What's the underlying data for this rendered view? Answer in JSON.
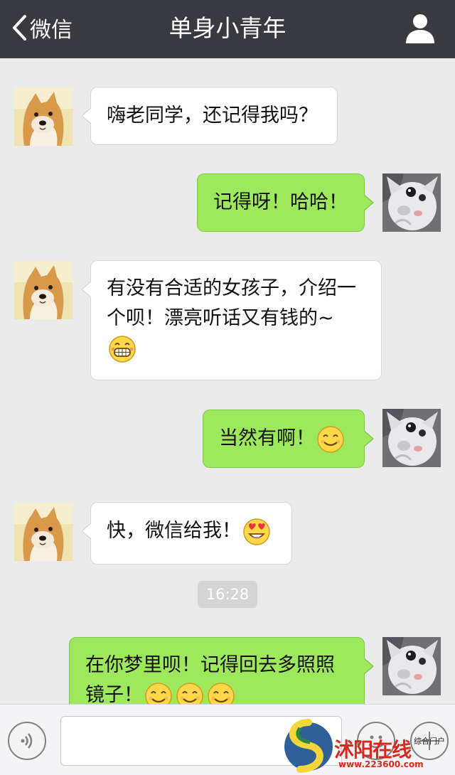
{
  "navbar": {
    "back_label": "微信",
    "title": "单身小青年",
    "back_icon": "chevron-left-icon",
    "profile_icon": "person-icon"
  },
  "messages": [
    {
      "side": "left",
      "sender": "friend",
      "avatar": "shiba-dog-avatar",
      "text": "嗨老同学，还记得我吗？"
    },
    {
      "side": "right",
      "sender": "me",
      "avatar": "white-cat-avatar",
      "text": "记得呀！哈哈！"
    },
    {
      "side": "left",
      "sender": "friend",
      "avatar": "shiba-dog-avatar",
      "text": "有没有合适的女孩子，介绍一个呗！漂亮听话又有钱的~",
      "emojis": [
        "grin-emoji"
      ]
    },
    {
      "side": "right",
      "sender": "me",
      "avatar": "white-cat-avatar",
      "text": "当然有啊！",
      "emojis": [
        "smile-emoji"
      ]
    },
    {
      "side": "left",
      "sender": "friend",
      "avatar": "shiba-dog-avatar",
      "text": "快，微信给我！",
      "emojis": [
        "heart-eyes-emoji"
      ]
    },
    {
      "side": "right",
      "sender": "me",
      "avatar": "white-cat-avatar",
      "text": "在你梦里呗！记得回去多照照镜子！",
      "emojis": [
        "smile-emoji",
        "smile-emoji",
        "smile-emoji"
      ]
    }
  ],
  "timestamp": "16:28",
  "input_bar": {
    "voice_icon": "voice-icon",
    "text_value": "",
    "emoji_icon": "emoji-icon",
    "plus_icon": "plus-icon"
  },
  "watermark": {
    "brand": "沭阳在线",
    "sub": "综合门户",
    "url": "www.223600.com"
  },
  "colors": {
    "navbar": "#393a3f",
    "background": "#ebebeb",
    "my_bubble": "#9de85c",
    "friend_bubble": "#ffffff",
    "watermark_red": "#d62a1e"
  }
}
